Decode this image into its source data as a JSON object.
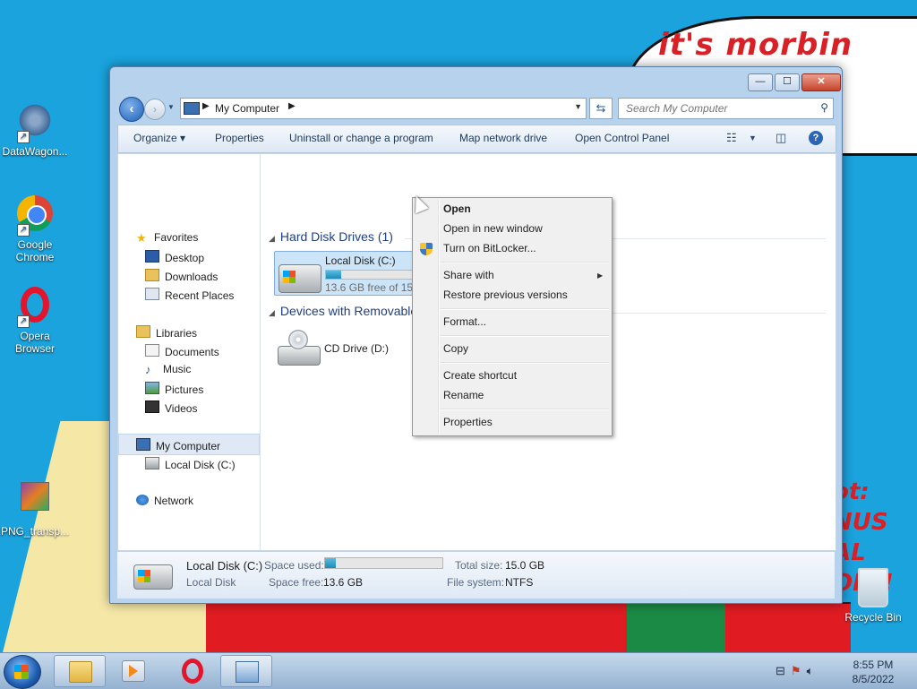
{
  "wallpaper": {
    "bubble_text": "it's morbin time",
    "side_text": [
      "ot:",
      "NUS",
      "AL",
      "ON!!"
    ]
  },
  "desktop": {
    "icons": [
      {
        "label": "DataWagon...",
        "icon": "datawagon-icon"
      },
      {
        "label": "Google Chrome",
        "icon": "chrome-icon"
      },
      {
        "label": "Opera Browser",
        "icon": "opera-icon"
      },
      {
        "label": "PNG_transp...",
        "icon": "png-file-icon"
      },
      {
        "label": "Recycle Bin",
        "icon": "recycle-bin-icon"
      }
    ]
  },
  "window": {
    "controls": {
      "minimize": "—",
      "maximize": "☐",
      "close": "✕"
    },
    "address": {
      "crumb": "My Computer"
    },
    "search": {
      "placeholder": "Search My Computer"
    },
    "commands": [
      "Organize ▾",
      "Properties",
      "Uninstall or change a program",
      "Map network drive",
      "Open Control Panel"
    ],
    "nav": {
      "favorites": "Favorites",
      "favorites_items": [
        "Desktop",
        "Downloads",
        "Recent Places"
      ],
      "libraries": "Libraries",
      "libraries_items": [
        "Documents",
        "Music",
        "Pictures",
        "Videos"
      ],
      "computer": "My Computer",
      "computer_items": [
        "Local Disk (C:)"
      ],
      "network": "Network"
    },
    "groups": {
      "hdd": "Hard Disk Drives (1)",
      "removable": "Devices with Removable Storage (1)"
    },
    "drives": {
      "c": {
        "name": "Local Disk (C:)",
        "free_text": "13.6 GB free of 15.0 GB",
        "used_fraction": 0.09
      },
      "d": {
        "name": "CD Drive (D:)"
      }
    },
    "details": {
      "name": "Local Disk (C:)",
      "type": "Local Disk",
      "space_used_label": "Space used:",
      "space_free_label": "Space free:",
      "space_free": "13.6 GB",
      "total_size_label": "Total size:",
      "total_size": "15.0 GB",
      "file_system_label": "File system:",
      "file_system": "NTFS",
      "used_fraction": 0.09
    }
  },
  "context_menu": {
    "items": [
      "Open",
      "Open in new window",
      "Turn on BitLocker...",
      "Share with",
      "Restore previous versions",
      "Format...",
      "Copy",
      "Create shortcut",
      "Rename",
      "Properties"
    ]
  },
  "taskbar": {
    "tray_icons": [
      "network-icon",
      "flag-icon",
      "volume-icon"
    ],
    "time": "8:55 PM",
    "date": "8/5/2022"
  }
}
